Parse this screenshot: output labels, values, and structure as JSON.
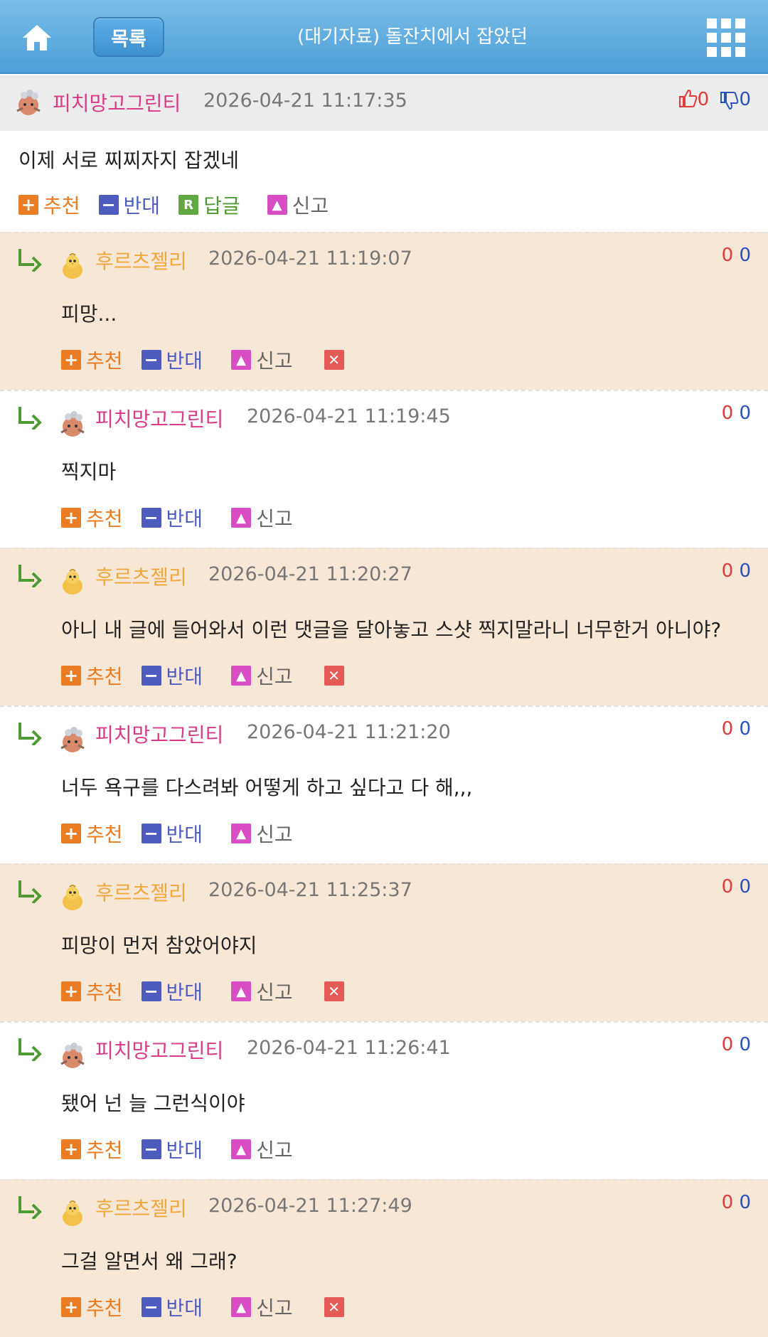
{
  "header": {
    "list_label": "목록",
    "title": "(대기자료) 돌잔치에서 잡았던"
  },
  "post": {
    "author": "피치망고그린티",
    "timestamp": "2026-04-21 11:17:35",
    "up": "0",
    "down": "0",
    "text": "이제 서로 찌찌자지 잡겠네",
    "actions": {
      "recommend": "추천",
      "oppose": "반대",
      "reply": "답글",
      "report": "신고"
    }
  },
  "labels": {
    "recommend": "추천",
    "oppose": "반대",
    "report": "신고"
  },
  "comments": [
    {
      "author": "후르츠젤리",
      "timestamp": "2026-04-21 11:19:07",
      "up": "0",
      "down": "0",
      "text": "피망...",
      "deletable": true
    },
    {
      "author": "피치망고그린티",
      "timestamp": "2026-04-21 11:19:45",
      "up": "0",
      "down": "0",
      "text": "찍지마",
      "deletable": false
    },
    {
      "author": "후르츠젤리",
      "timestamp": "2026-04-21 11:20:27",
      "up": "0",
      "down": "0",
      "text": "아니 내 글에 들어와서 이런 댓글을 달아놓고 스샷 찍지말라니 너무한거 아니야?",
      "deletable": true
    },
    {
      "author": "피치망고그린티",
      "timestamp": "2026-04-21 11:21:20",
      "up": "0",
      "down": "0",
      "text": "너두 욕구를 다스려봐 어떻게 하고 싶다고 다 해,,,",
      "deletable": false
    },
    {
      "author": "후르츠젤리",
      "timestamp": "2026-04-21 11:25:37",
      "up": "0",
      "down": "0",
      "text": "피망이 먼저 참았어야지",
      "deletable": true
    },
    {
      "author": "피치망고그린티",
      "timestamp": "2026-04-21 11:26:41",
      "up": "0",
      "down": "0",
      "text": "됐어 넌 늘 그런식이야",
      "deletable": false
    },
    {
      "author": "후르츠젤리",
      "timestamp": "2026-04-21 11:27:49",
      "up": "0",
      "down": "0",
      "text": "그걸 알면서 왜 그래?",
      "deletable": true
    }
  ],
  "colors": {
    "header_blue": "#4d9fd8",
    "beige_row": "#f7e7d6",
    "nick_pink": "#d83a87",
    "nick_orange": "#f0a83c"
  }
}
